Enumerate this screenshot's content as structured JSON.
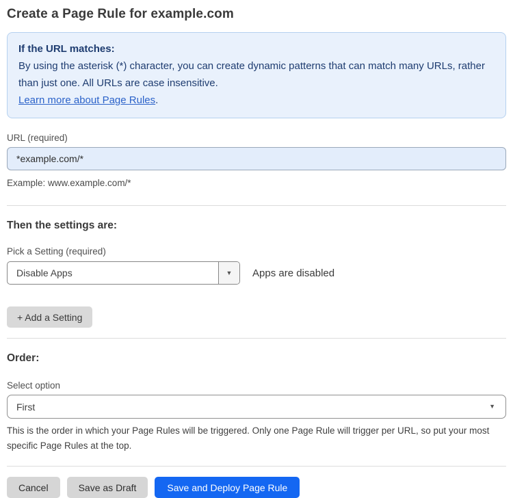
{
  "page": {
    "title": "Create a Page Rule for example.com"
  },
  "info_box": {
    "heading": "If the URL matches:",
    "body": "By using the asterisk (*) character, you can create dynamic patterns that can match many URLs, rather than just one. All URLs are case insensitive.",
    "link": "Learn more about Page Rules",
    "link_suffix": "."
  },
  "url_field": {
    "label": "URL (required)",
    "value": "*example.com/*",
    "helper": "Example: www.example.com/*"
  },
  "settings": {
    "heading": "Then the settings are:",
    "picker_label": "Pick a Setting (required)",
    "selected_value": "Disable Apps",
    "status_text": "Apps are disabled",
    "add_button_label": "+ Add a Setting",
    "caret_glyph": "▼"
  },
  "order": {
    "heading": "Order:",
    "label": "Select option",
    "selected_value": "First",
    "helper": "This is the order in which your Page Rules will be triggered. Only one Page Rule will trigger per URL, so put your most specific Page Rules at the top.",
    "caret_glyph": "▼"
  },
  "actions": {
    "cancel_label": "Cancel",
    "save_draft_label": "Save as Draft",
    "save_deploy_label": "Save and Deploy Page Rule"
  },
  "colors": {
    "accent_blue": "#1467f2",
    "info_box_bg": "#e9f1fc",
    "info_box_border": "#b5d1ef",
    "info_box_text": "#1e3c70",
    "link_blue": "#2b62c9",
    "url_input_bg": "#e3edfb",
    "gray_button_bg": "#d6d6d6"
  }
}
